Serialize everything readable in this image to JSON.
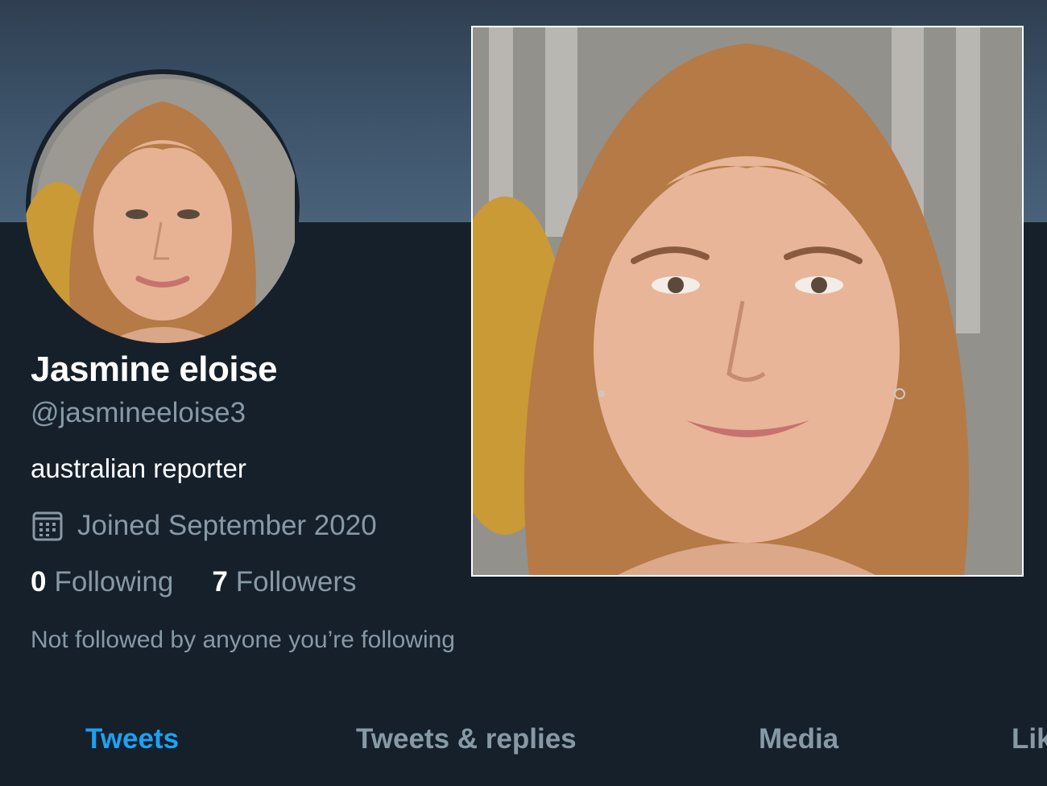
{
  "profile": {
    "name": "Jasmine eloise",
    "handle": "@jasmineeloise3",
    "bio": "australian reporter",
    "joined": "Joined September 2020",
    "following_count": "0",
    "following_label": "Following",
    "followers_count": "7",
    "followers_label": "Followers",
    "followed_note": "Not followed by anyone you’re following"
  },
  "tabs": [
    {
      "label": "Tweets",
      "active": true
    },
    {
      "label": "Tweets & replies",
      "active": false
    },
    {
      "label": "Media",
      "active": false
    },
    {
      "label": "Lik",
      "active": false
    }
  ],
  "colors": {
    "background": "#15202b",
    "banner": "#3d546b",
    "accent": "#1da1f2",
    "secondary_text": "#8899a6"
  },
  "icons": {
    "joined": "calendar-icon"
  }
}
